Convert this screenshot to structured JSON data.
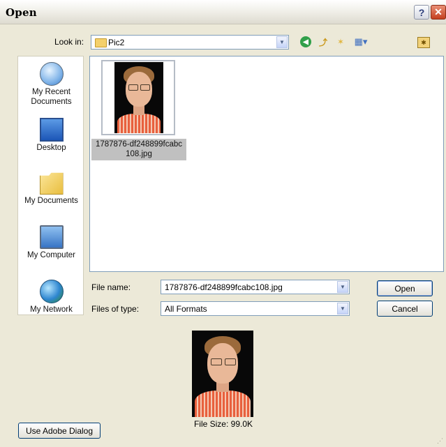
{
  "window": {
    "title": "Open",
    "help_label": "?",
    "close_label": "✕"
  },
  "toolbar": {
    "look_in_label": "Look in:",
    "look_in_value": "Pic2",
    "icons": [
      "back-icon",
      "up-folder-icon",
      "new-folder-icon",
      "views-menu-icon",
      "desktop-folder-icon"
    ]
  },
  "places": [
    {
      "label": "My Recent Documents",
      "icon": "recent-documents-icon"
    },
    {
      "label": "Desktop",
      "icon": "desktop-icon"
    },
    {
      "label": "My Documents",
      "icon": "my-documents-icon"
    },
    {
      "label": "My Computer",
      "icon": "my-computer-icon"
    },
    {
      "label": "My Network",
      "icon": "my-network-icon"
    }
  ],
  "files": [
    {
      "name_line1": "1787876-df248899fcabc",
      "name_line2": "108.jpg",
      "selected": true
    }
  ],
  "form": {
    "file_name_label": "File name:",
    "file_name_value": "1787876-df248899fcabc108.jpg",
    "files_of_type_label": "Files of type:",
    "files_of_type_value": "All Formats"
  },
  "buttons": {
    "open": "Open",
    "cancel": "Cancel",
    "adobe": "Use Adobe Dialog"
  },
  "preview": {
    "file_size": "File Size: 99.0K"
  },
  "colors": {
    "dialog_bg": "#ece9d8",
    "selection": "#c0c0c0",
    "field_border": "#7f9db9"
  }
}
